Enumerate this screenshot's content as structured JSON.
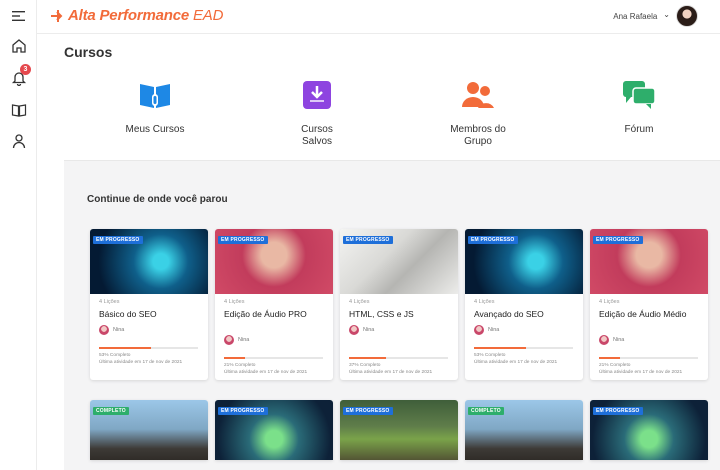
{
  "brand": {
    "name": "Alta Performance",
    "suffix": "EAD",
    "color": "#f26b3a"
  },
  "user": {
    "name": "Ana Rafaela",
    "dropdown": "⌄"
  },
  "sidebar": {
    "notifications_count": "3"
  },
  "page_title": "Cursos",
  "shortcuts": [
    {
      "label": "Meus Cursos",
      "icon": "book-icon",
      "color": "#1e88e5"
    },
    {
      "label": "Cursos Salvos",
      "icon": "download-icon",
      "color": "#8e44e0"
    },
    {
      "label": "Membros do Grupo",
      "icon": "group-icon",
      "color": "#f26b3a"
    },
    {
      "label": "Fórum",
      "icon": "chat-icon",
      "color": "#2eae6b"
    }
  ],
  "section_title": "Continue de onde você parou",
  "cards": [
    {
      "status": "EM PROGRESSO",
      "lessons": "4 Lições",
      "title": "Básico do SEO",
      "author": "Nina",
      "progress_text": "53% Completo",
      "progress": 53,
      "last": "Última atividade em 17 de nov de 2021"
    },
    {
      "status": "EM PROGRESSO",
      "lessons": "4 Lições",
      "title": "Edição de Áudio PRO",
      "author": "Nina",
      "progress_text": "21% Completo",
      "progress": 21,
      "last": "Última atividade em 17 de nov de 2021"
    },
    {
      "status": "EM PROGRESSO",
      "lessons": "4 Lições",
      "title": "HTML, CSS e JS",
      "author": "Nina",
      "progress_text": "37% Completo",
      "progress": 37,
      "last": "Última atividade em 17 de nov de 2021"
    },
    {
      "status": "EM PROGRESSO",
      "lessons": "4 Lições",
      "title": "Avançado do SEO",
      "author": "Nina",
      "progress_text": "53% Completo",
      "progress": 53,
      "last": "Última atividade em 17 de nov de 2021"
    },
    {
      "status": "EM PROGRESSO",
      "lessons": "4 Lições",
      "title": "Edição de Áudio Médio",
      "author": "Nina",
      "progress_text": "21% Completo",
      "progress": 21,
      "last": "Última atividade em 17 de nov de 2021"
    }
  ],
  "bottom_cards": [
    {
      "status": "COMPLETO"
    },
    {
      "status": "EM PROGRESSO"
    },
    {
      "status": "EM PROGRESSO"
    },
    {
      "status": "COMPLETO"
    },
    {
      "status": "EM PROGRESSO"
    }
  ]
}
